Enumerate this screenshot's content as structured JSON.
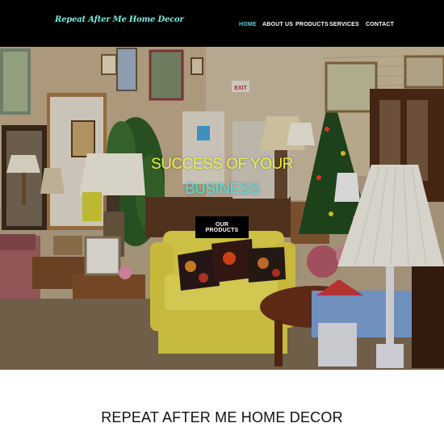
{
  "header": {
    "logo_text": "Repeat After Me Home Decor",
    "nav": [
      {
        "label": "HOME",
        "active": true
      },
      {
        "label": "ABOUT US",
        "active": false
      },
      {
        "label": "PRODUCTS",
        "active": false
      },
      {
        "label": "SERVICES",
        "active": false
      },
      {
        "label": "CONTACT",
        "active": false
      }
    ]
  },
  "hero": {
    "headline_line1": "SUCCESS OF YOUR",
    "headline_line2": "BUSINESS",
    "cta_label": "OUR PRODUCTS",
    "exit_sign": "EXIT"
  },
  "footer": {
    "site_title": "REPEAT AFTER ME HOME DECOR"
  },
  "colors": {
    "header_bg": "#000000",
    "logo": "#7ee8e0",
    "nav_active": "#4fd8d8",
    "headline_yellow": "#e8f04a",
    "headline_teal": "#54e0d8",
    "sofa": "#ecdf55"
  }
}
